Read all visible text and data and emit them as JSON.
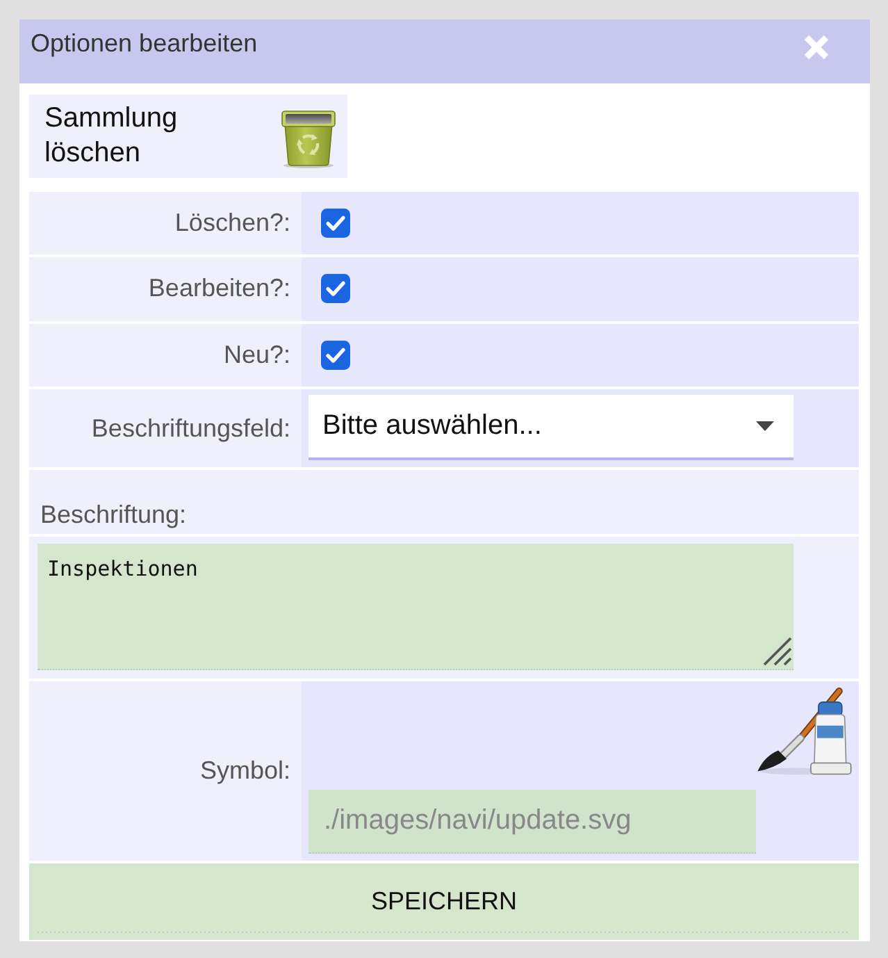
{
  "dialog": {
    "title": "Optionen bearbeiten"
  },
  "delete_button": {
    "label": "Sammlung löschen"
  },
  "form": {
    "options": [
      {
        "label": "Löschen?:",
        "checked": true
      },
      {
        "label": "Bearbeiten?:",
        "checked": true
      },
      {
        "label": "Neu?:",
        "checked": true
      }
    ],
    "label_field": {
      "label": "Beschriftungsfeld:",
      "value": "Bitte auswählen..."
    },
    "caption": {
      "label": "Beschriftung:",
      "value": "Inspektionen"
    },
    "symbol": {
      "label": "Symbol:",
      "placeholder": "./images/navi/update.svg"
    }
  },
  "save_button": {
    "label": "SPEICHERN"
  }
}
